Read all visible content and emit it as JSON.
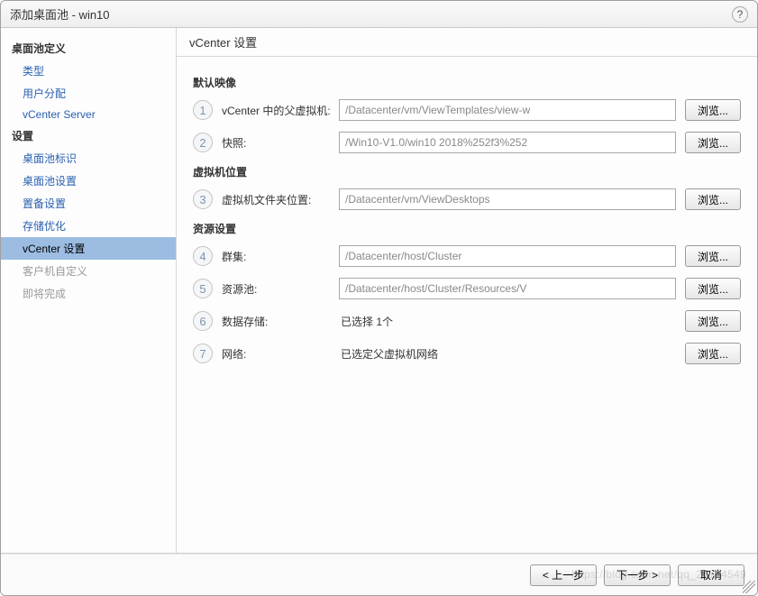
{
  "window": {
    "title": "添加桌面池 - win10",
    "help_tooltip": "?"
  },
  "sidebar": {
    "sections": [
      {
        "label": "桌面池定义",
        "items": [
          {
            "label": "类型",
            "selected": false,
            "disabled": false
          },
          {
            "label": "用户分配",
            "selected": false,
            "disabled": false
          },
          {
            "label": "vCenter Server",
            "selected": false,
            "disabled": false
          }
        ]
      },
      {
        "label": "设置",
        "items": [
          {
            "label": "桌面池标识",
            "selected": false,
            "disabled": false
          },
          {
            "label": "桌面池设置",
            "selected": false,
            "disabled": false
          },
          {
            "label": "置备设置",
            "selected": false,
            "disabled": false
          },
          {
            "label": "存储优化",
            "selected": false,
            "disabled": false
          },
          {
            "label": "vCenter 设置",
            "selected": true,
            "disabled": false
          },
          {
            "label": "客户机自定义",
            "selected": false,
            "disabled": true
          },
          {
            "label": "即将完成",
            "selected": false,
            "disabled": true
          }
        ]
      }
    ]
  },
  "main": {
    "header": "vCenter 设置",
    "sections": [
      {
        "title": "默认映像",
        "rows": [
          {
            "num": "1",
            "label": "vCenter 中的父虚拟机:",
            "value": "/Datacenter/vm/ViewTemplates/view-w",
            "browse": "浏览...",
            "input": true
          },
          {
            "num": "2",
            "label": "快照:",
            "value": "/Win10-V1.0/win10 2018%252f3%252",
            "browse": "浏览...",
            "input": true
          }
        ]
      },
      {
        "title": "虚拟机位置",
        "rows": [
          {
            "num": "3",
            "label": "虚拟机文件夹位置:",
            "value": "/Datacenter/vm/ViewDesktops",
            "browse": "浏览...",
            "input": true
          }
        ]
      },
      {
        "title": "资源设置",
        "rows": [
          {
            "num": "4",
            "label": "群集:",
            "value": "/Datacenter/host/Cluster",
            "browse": "浏览...",
            "input": true
          },
          {
            "num": "5",
            "label": "资源池:",
            "value": "/Datacenter/host/Cluster/Resources/V",
            "browse": "浏览...",
            "input": true
          },
          {
            "num": "6",
            "label": "数据存储:",
            "value": "已选择 1个",
            "browse": "浏览...",
            "input": false
          },
          {
            "num": "7",
            "label": "网络:",
            "value": "已选定父虚拟机网络",
            "browse": "浏览...",
            "input": false
          }
        ]
      }
    ]
  },
  "footer": {
    "prev": "< 上一步",
    "next": "下一步 >",
    "cancel": "取消"
  },
  "watermark": "https://blog.csdn.net/qq_25774549"
}
